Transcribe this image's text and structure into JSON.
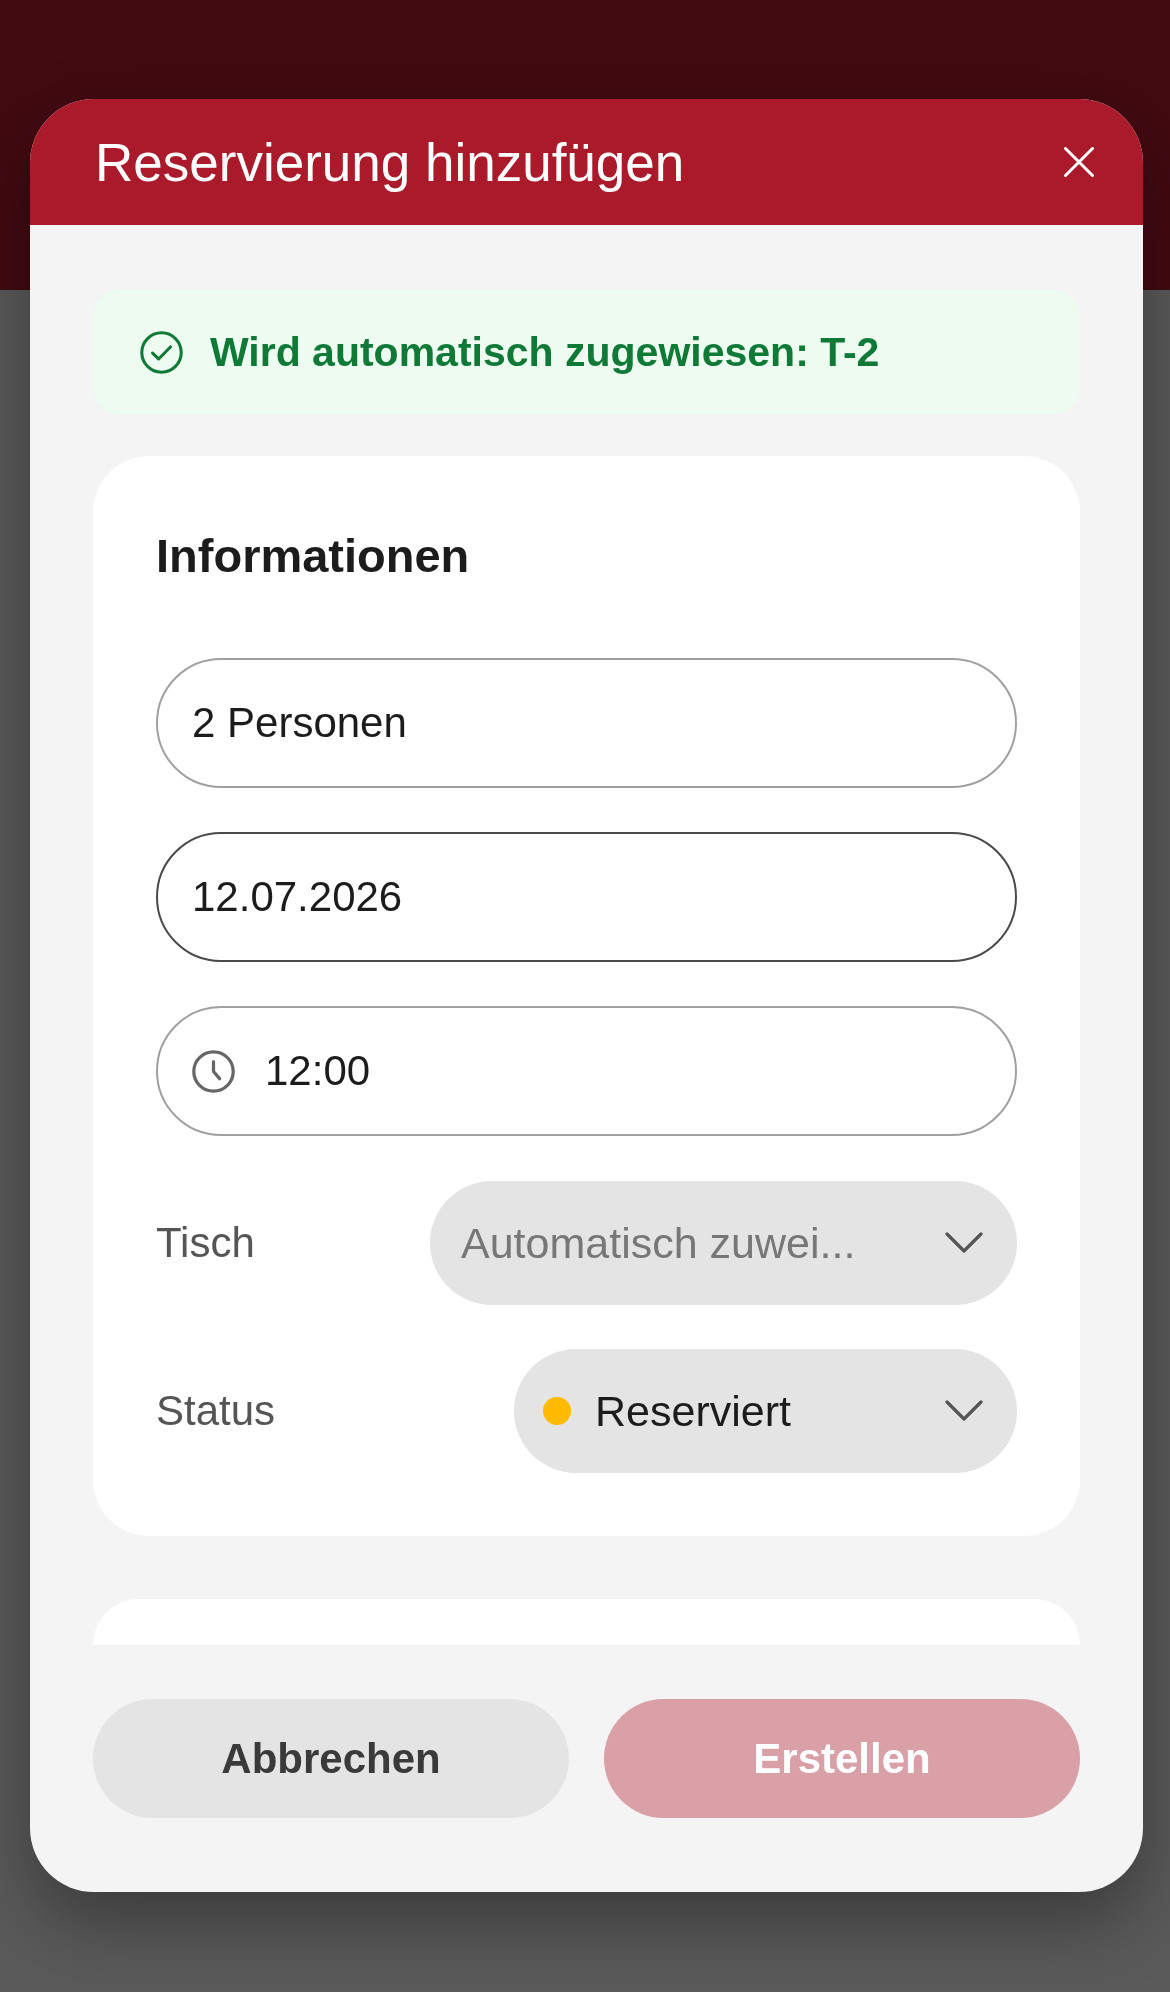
{
  "dialog": {
    "title": "Reservierung hinzufügen"
  },
  "notice": {
    "text": "Wird automatisch zugewiesen: T-2"
  },
  "information": {
    "heading": "Informationen",
    "fields": [
      {
        "kind": "text",
        "value": "2 Personen",
        "focused": false
      },
      {
        "kind": "text",
        "value": "12.07.2026",
        "focused": true
      },
      {
        "kind": "time",
        "value": "12:00",
        "focused": false
      }
    ],
    "selects": [
      {
        "label": "Tisch",
        "placeholder": "Automatisch zuwei..."
      },
      {
        "label": "Status",
        "value": "Reserviert",
        "color": "#ffbb00"
      }
    ]
  },
  "buttons": [
    {
      "kind": "secondary",
      "label": "Abbrechen",
      "disabled": false
    },
    {
      "kind": "primary",
      "label": "Erstellen",
      "disabled": true
    }
  ]
}
